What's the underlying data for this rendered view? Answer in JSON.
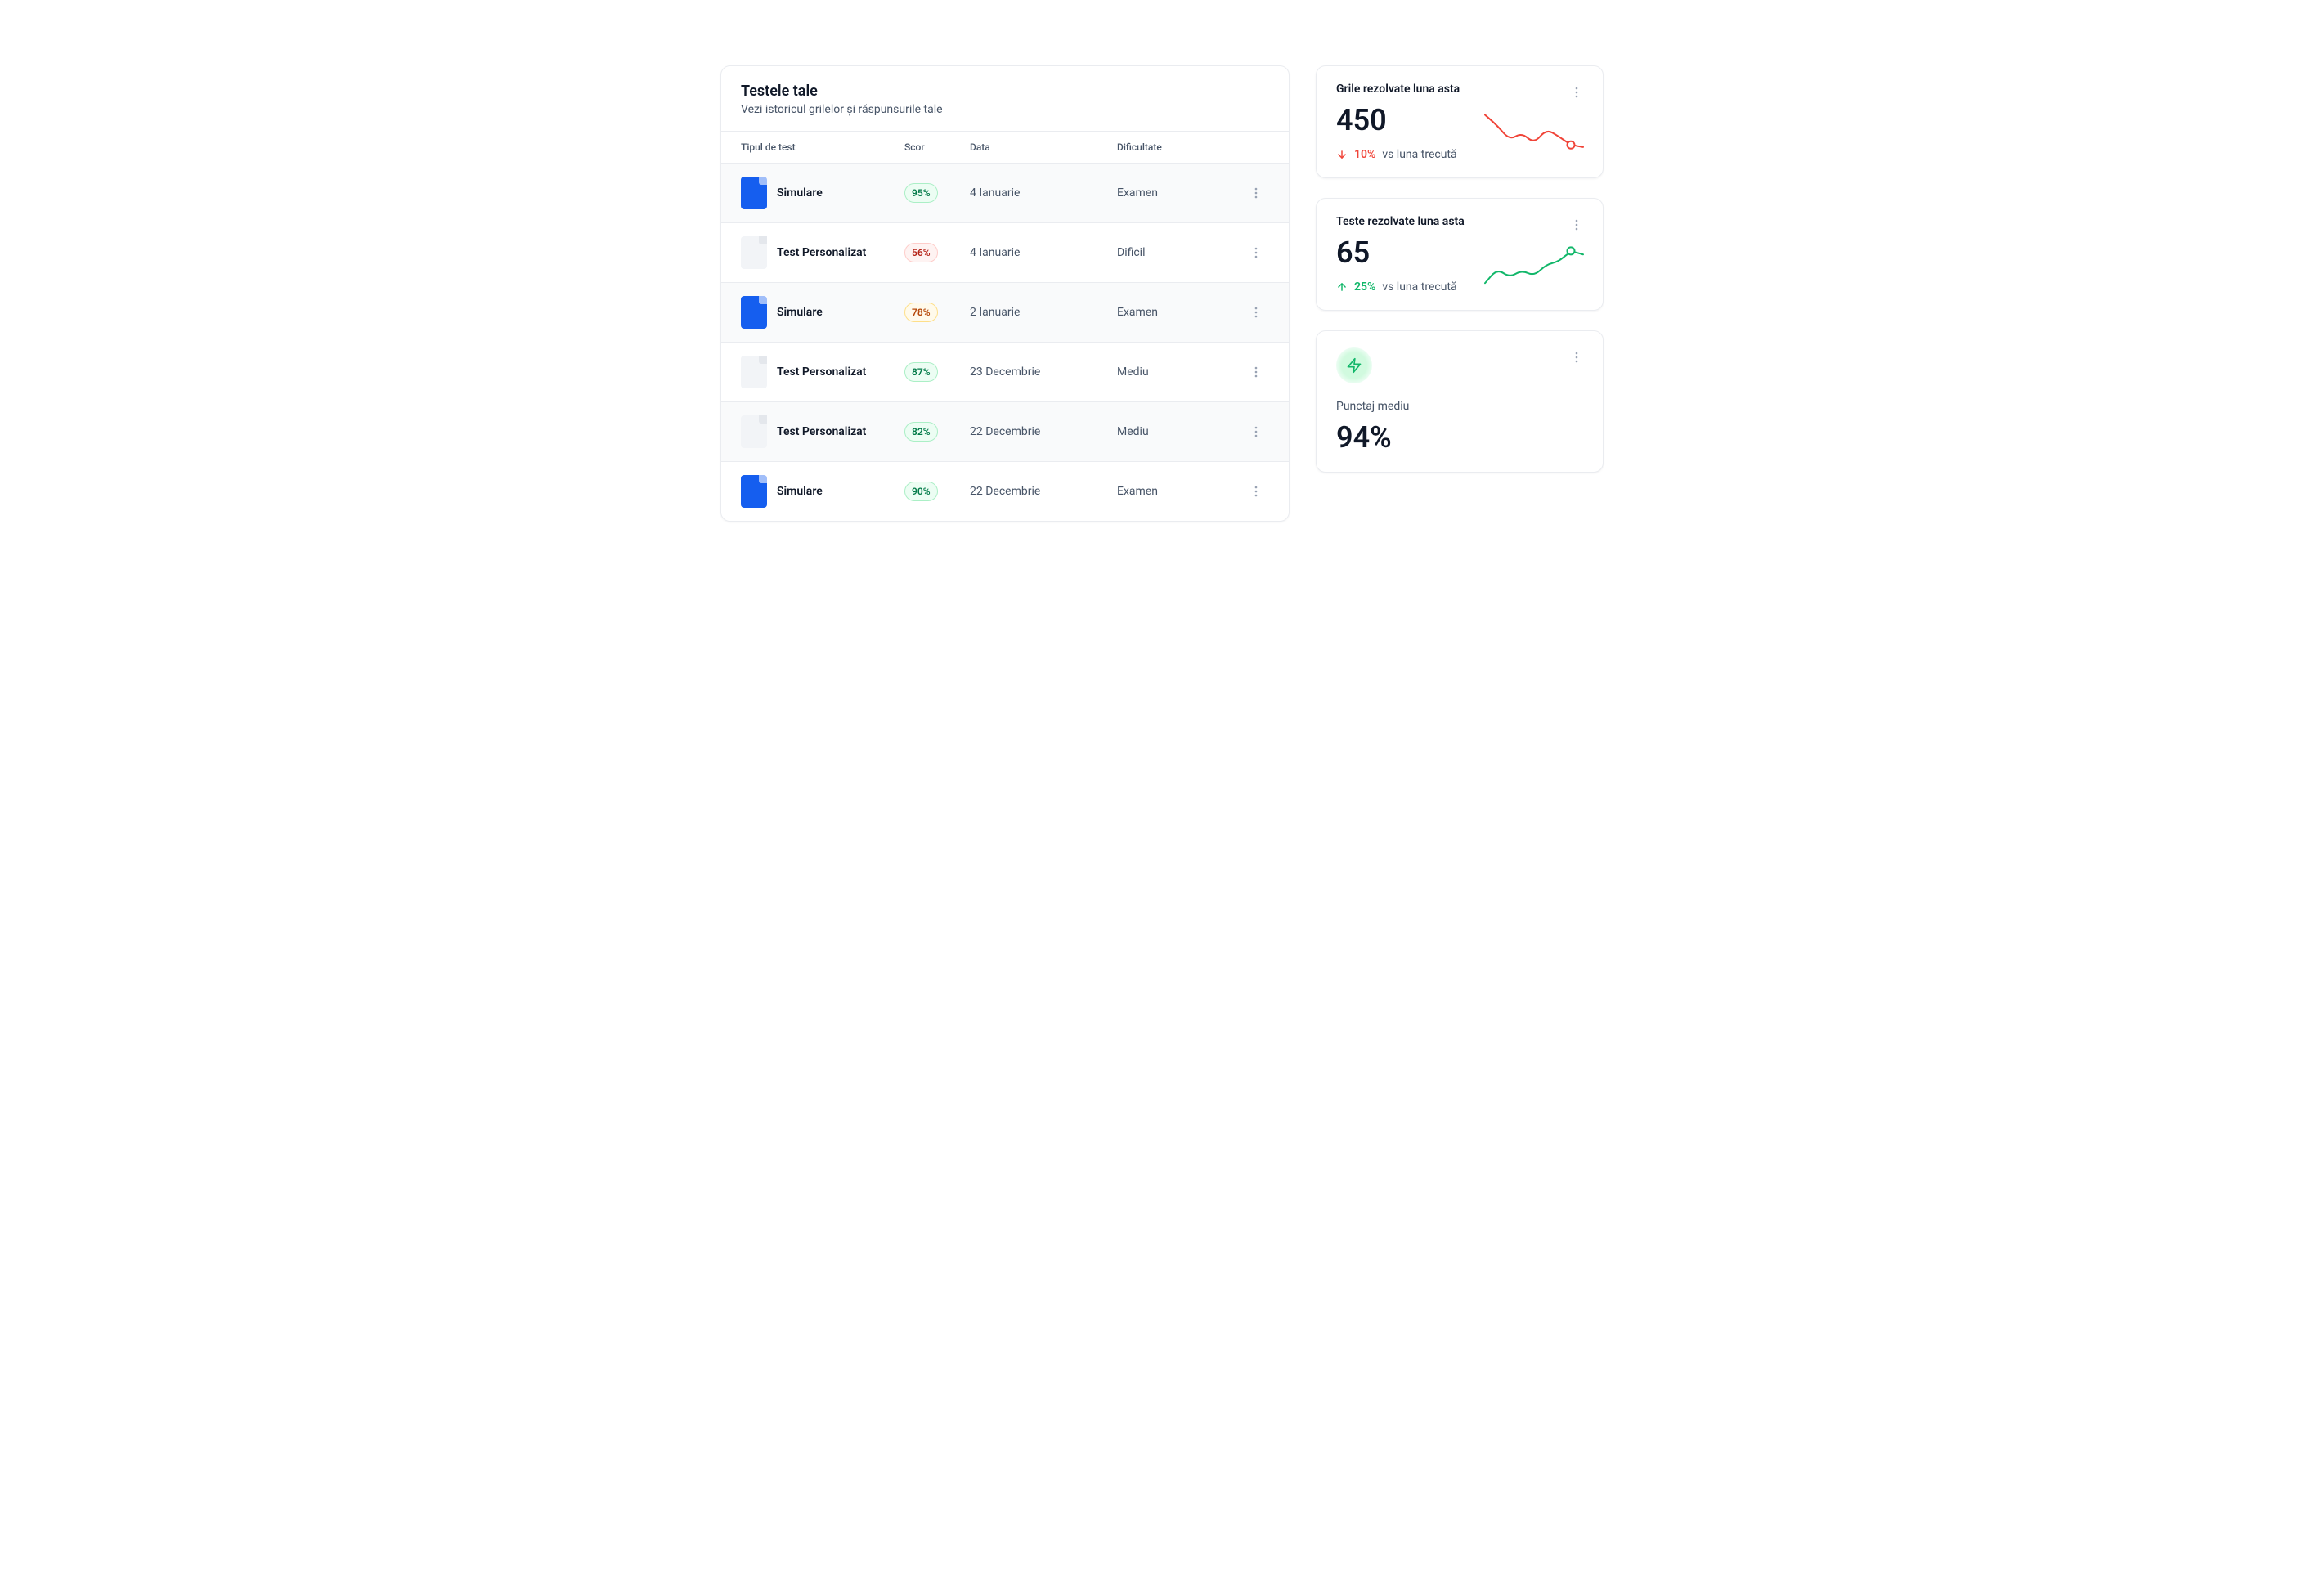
{
  "tests": {
    "title": "Testele tale",
    "subtitle": "Vezi istoricul grilelor și răspunsurile tale",
    "columns": {
      "type": "Tipul de test",
      "score": "Scor",
      "date": "Data",
      "difficulty": "Dificultate"
    },
    "rows": [
      {
        "type_label": "Simulare",
        "icon": "blue",
        "score": "95%",
        "score_color": "green",
        "date": "4 Ianuarie",
        "difficulty": "Examen",
        "alt": true
      },
      {
        "type_label": "Test Personalizat",
        "icon": "grey",
        "score": "56%",
        "score_color": "red",
        "date": "4 Ianuarie",
        "difficulty": "Dificil",
        "alt": false
      },
      {
        "type_label": "Simulare",
        "icon": "blue",
        "score": "78%",
        "score_color": "orange",
        "date": "2 Ianuarie",
        "difficulty": "Examen",
        "alt": true
      },
      {
        "type_label": "Test Personalizat",
        "icon": "grey",
        "score": "87%",
        "score_color": "green",
        "date": "23 Decembrie",
        "difficulty": "Mediu",
        "alt": false
      },
      {
        "type_label": "Test Personalizat",
        "icon": "grey",
        "score": "82%",
        "score_color": "green",
        "date": "22 Decembrie",
        "difficulty": "Mediu",
        "alt": true
      },
      {
        "type_label": "Simulare",
        "icon": "blue",
        "score": "90%",
        "score_color": "green",
        "date": "22 Decembrie",
        "difficulty": "Examen",
        "alt": false
      }
    ]
  },
  "cards": {
    "grile": {
      "title": "Grile rezolvate luna asta",
      "value": "450",
      "trend_dir": "down",
      "trend_pct": "10%",
      "trend_vs": "vs luna trecută"
    },
    "teste": {
      "title": "Teste rezolvate luna asta",
      "value": "65",
      "trend_dir": "up",
      "trend_pct": "25%",
      "trend_vs": "vs luna trecută"
    },
    "punctaj": {
      "label": "Punctaj mediu",
      "value": "94%"
    }
  },
  "chart_data": [
    {
      "type": "line",
      "title": "Grile rezolvate luna asta",
      "series": [
        {
          "name": "grile",
          "values": [
            60,
            45,
            25,
            35,
            20,
            40,
            30,
            18,
            15
          ]
        }
      ],
      "x": [
        0,
        1,
        2,
        3,
        4,
        5,
        6,
        7,
        8
      ],
      "xlabel": "",
      "ylabel": "",
      "ylim": [
        0,
        64
      ],
      "color": "#F04438",
      "highlight_index": 7
    },
    {
      "type": "line",
      "title": "Teste rezolvate luna asta",
      "series": [
        {
          "name": "teste",
          "values": [
            10,
            30,
            18,
            28,
            20,
            36,
            40,
            55,
            50
          ]
        }
      ],
      "x": [
        0,
        1,
        2,
        3,
        4,
        5,
        6,
        7,
        8
      ],
      "xlabel": "",
      "ylabel": "",
      "ylim": [
        0,
        64
      ],
      "color": "#12B76A",
      "highlight_index": 7
    }
  ]
}
